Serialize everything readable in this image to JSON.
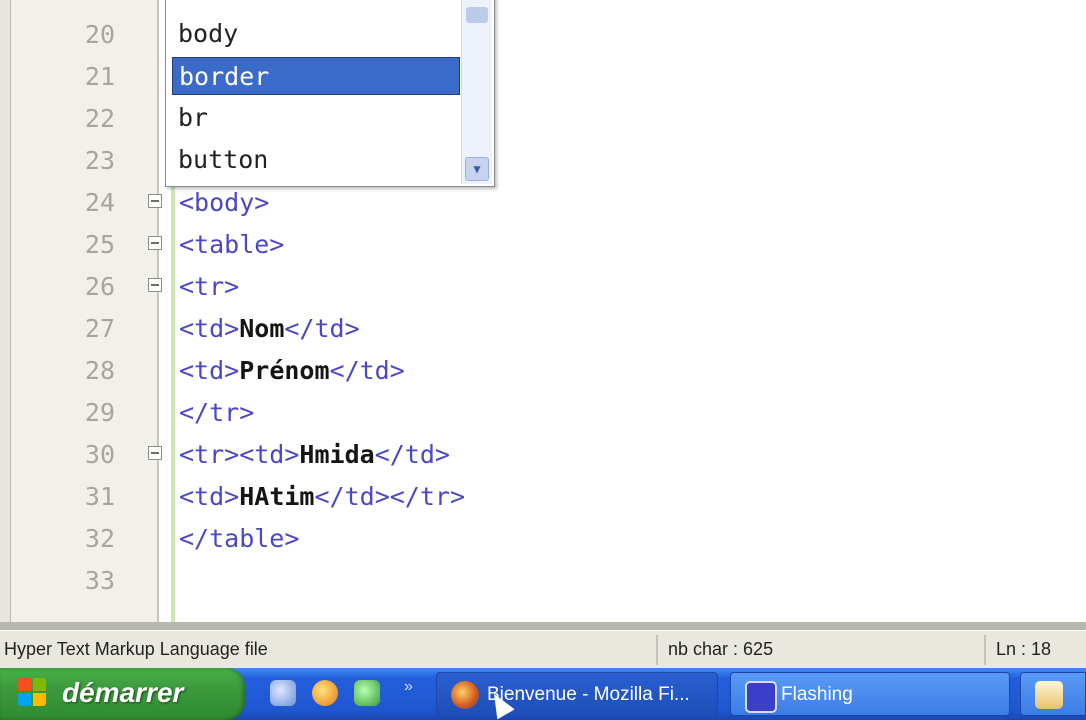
{
  "editor": {
    "lines": [
      {
        "num": "20",
        "code": "",
        "fold": false
      },
      {
        "num": "21",
        "code": "",
        "fold": false
      },
      {
        "num": "22",
        "code": "",
        "fold": false
      },
      {
        "num": "23",
        "code": "",
        "fold": false
      },
      {
        "num": "24",
        "code": "<body>",
        "fold": true
      },
      {
        "num": "25",
        "code": "<table>",
        "fold": true
      },
      {
        "num": "26",
        "code": "<tr>",
        "fold": true
      },
      {
        "num": "27",
        "code_open": "<td>",
        "code_text": "Nom",
        "code_close": "</td>",
        "fold": false
      },
      {
        "num": "28",
        "code_open": "<td>",
        "code_text": "Prénom",
        "code_close": "</td>",
        "fold": false
      },
      {
        "num": "29",
        "code": "</tr>",
        "fold": false
      },
      {
        "num": "30",
        "code_open": "<tr><td>",
        "code_text": "Hmida",
        "code_close": "</td>",
        "fold": true
      },
      {
        "num": "31",
        "code_open": "<td>",
        "code_text": "HAtim",
        "code_close": "</td></tr>",
        "fold": false
      },
      {
        "num": "32",
        "code": "</table>",
        "fold": false
      },
      {
        "num": "33",
        "code": "",
        "fold": false
      }
    ]
  },
  "autocomplete": {
    "items": [
      "body",
      "border",
      "br",
      "button"
    ],
    "selected": "border"
  },
  "statusbar": {
    "file_type": "Hyper Text Markup Language file",
    "char_count": "nb char : 625",
    "line": "Ln : 18"
  },
  "taskbar": {
    "start_label": "démarrer",
    "tasks": [
      {
        "label": "Bienvenue - Mozilla Fi..."
      },
      {
        "label": "Flashing"
      }
    ]
  },
  "colors": {
    "tag": "#4b48c8",
    "selection": "#3b6bc9",
    "taskbar": "#245edb",
    "start": "#3c9a3c"
  }
}
